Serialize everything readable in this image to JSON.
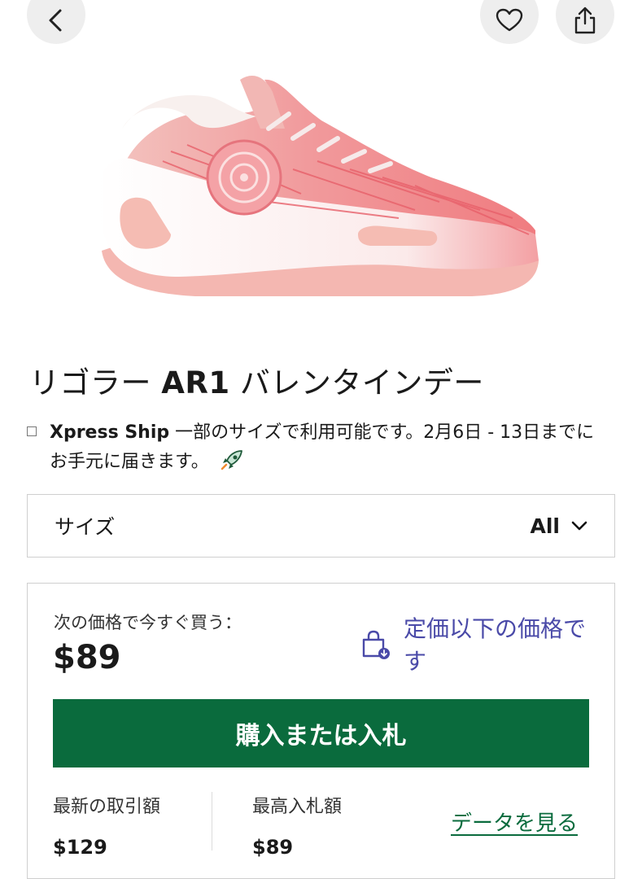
{
  "product": {
    "title_jp_prefix": "リゴラー ",
    "title_model": "AR1",
    "title_jp_suffix": " バレンタインデー"
  },
  "shipping": {
    "brand": "Xpress Ship",
    "text_line1": " 一部のサイズで利用可能です。2月6日 - 13日までに",
    "text_line2": "お手元に届きます。"
  },
  "size_selector": {
    "label": "サイズ",
    "value": "All"
  },
  "buy": {
    "now_label": "次の価格で今すぐ買う：",
    "now_price": "$89",
    "below_retail": "定価以下の価格です",
    "button_label": "購入または入札",
    "last_sale_label": "最新の取引額",
    "last_sale_value": "$129",
    "highest_bid_label": "最高入札額",
    "highest_bid_value": "$89",
    "view_data_link": "データを見る"
  },
  "colors": {
    "accent_green": "#0a6b3d",
    "link_purple": "#4a4aa8"
  },
  "icons": {
    "back": "chevron-left-icon",
    "favorite": "heart-icon",
    "share": "share-icon",
    "shipping": "rocket-icon",
    "size_dropdown": "chevron-down-icon",
    "below_retail": "shopping-bag-icon"
  }
}
